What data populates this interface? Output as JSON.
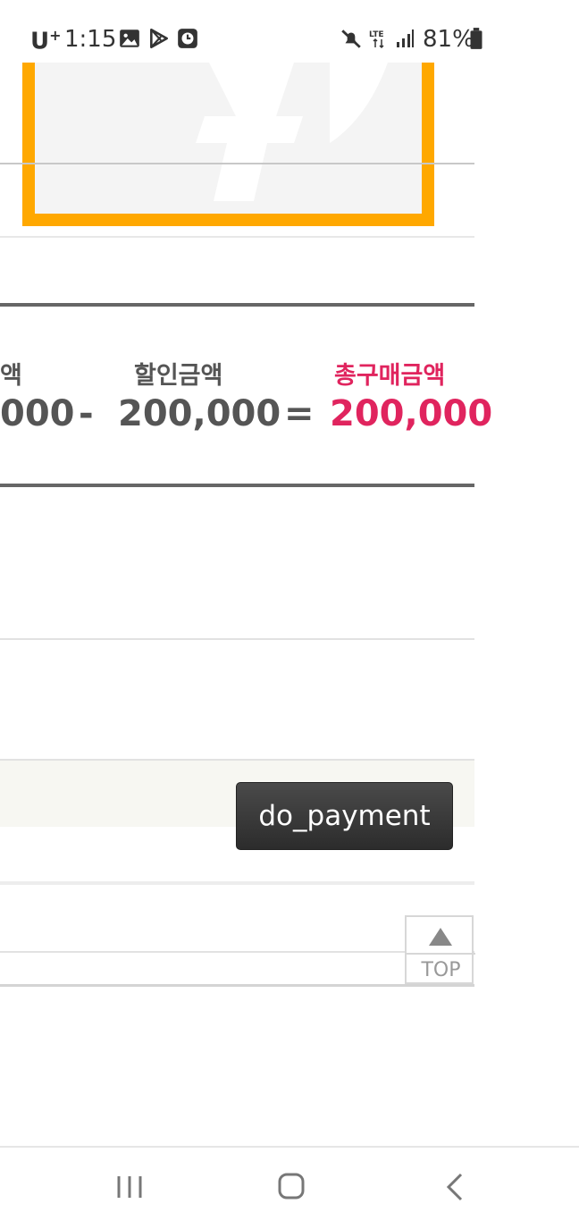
{
  "status_bar": {
    "carrier": "U",
    "carrier_plus": "+",
    "time": "1:15",
    "battery": "81%",
    "icons": [
      "gallery-icon",
      "play-store-icon",
      "clock-app-icon",
      "mute-icon",
      "lte-icon",
      "signal-icon",
      "battery-icon"
    ]
  },
  "summary": {
    "col1_label": "액",
    "col1_value": "000",
    "minus": "-",
    "discount_label": "할인금액",
    "discount_value": "200,000",
    "equals": "=",
    "total_label": "총구매금액",
    "total_value": "200,000"
  },
  "payment": {
    "button_label": "do_payment"
  },
  "top_button": {
    "label": "TOP"
  },
  "colors": {
    "accent_orange": "#FFA800",
    "total_pink": "#E0245E",
    "button_dark": "#333333"
  },
  "nav_bar": {
    "buttons": [
      "recents-icon",
      "home-icon",
      "back-icon"
    ]
  }
}
